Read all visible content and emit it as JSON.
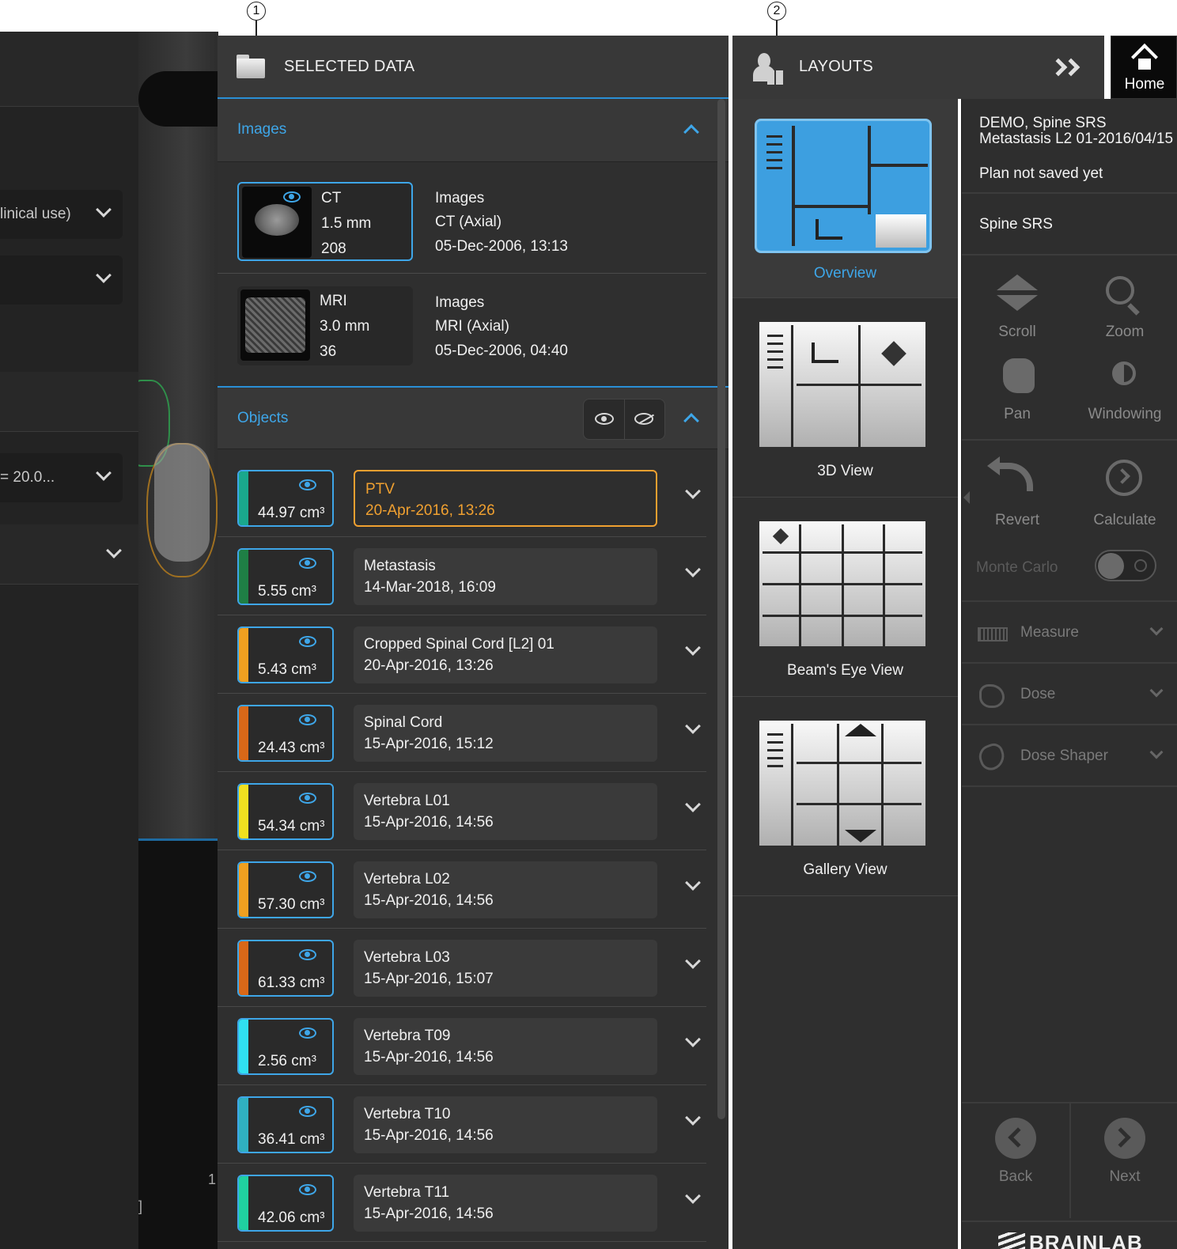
{
  "callouts": [
    "1",
    "2"
  ],
  "left_panel": {
    "dropdown1": "linical use)",
    "dropdown3": "= 20.0...",
    "lower_text_1": "1",
    "lower_text_2": "]"
  },
  "selected_data": {
    "title": "SELECTED DATA",
    "images_label": "Images",
    "images": [
      {
        "modality": "CT",
        "slice": "1.5 mm",
        "count": "208",
        "type": "Images",
        "desc": "CT (Axial)",
        "date": "05-Dec-2006, 13:13",
        "selected": true
      },
      {
        "modality": "MRI",
        "slice": "3.0 mm",
        "count": "36",
        "type": "Images",
        "desc": "MRI (Axial)",
        "date": "05-Dec-2006, 04:40",
        "selected": false
      }
    ],
    "objects_label": "Objects",
    "objects": [
      {
        "volume": "44.97 cm³",
        "name": "PTV",
        "date": "20-Apr-2016, 13:26",
        "color": "#1aa88c",
        "selected": true
      },
      {
        "volume": "5.55 cm³",
        "name": "Metastasis",
        "date": "14-Mar-2018, 16:09",
        "color": "#1f7f45",
        "selected": false
      },
      {
        "volume": "5.43 cm³",
        "name": "Cropped Spinal Cord [L2] 01",
        "date": "20-Apr-2016, 13:26",
        "color": "#f0a020",
        "selected": false
      },
      {
        "volume": "24.43 cm³",
        "name": "Spinal Cord",
        "date": "15-Apr-2016, 15:12",
        "color": "#d86818",
        "selected": false
      },
      {
        "volume": "54.34 cm³",
        "name": "Vertebra L01",
        "date": "15-Apr-2016, 14:56",
        "color": "#f0e020",
        "selected": false
      },
      {
        "volume": "57.30 cm³",
        "name": "Vertebra L02",
        "date": "15-Apr-2016, 14:56",
        "color": "#f0a020",
        "selected": false
      },
      {
        "volume": "61.33 cm³",
        "name": "Vertebra L03",
        "date": "15-Apr-2016, 15:07",
        "color": "#d86818",
        "selected": false
      },
      {
        "volume": "2.56 cm³",
        "name": "Vertebra T09",
        "date": "15-Apr-2016, 14:56",
        "color": "#30e0f0",
        "selected": false
      },
      {
        "volume": "36.41 cm³",
        "name": "Vertebra T10",
        "date": "15-Apr-2016, 14:56",
        "color": "#30b0c0",
        "selected": false
      },
      {
        "volume": "42.06 cm³",
        "name": "Vertebra T11",
        "date": "15-Apr-2016, 14:56",
        "color": "#20d0a0",
        "selected": false
      }
    ]
  },
  "layouts": {
    "title": "LAYOUTS",
    "items": [
      {
        "label": "Overview",
        "selected": true
      },
      {
        "label": "3D View",
        "selected": false
      },
      {
        "label": "Beam's Eye View",
        "selected": false
      },
      {
        "label": "Gallery View",
        "selected": false
      }
    ]
  },
  "home": {
    "label": "Home"
  },
  "right_panel": {
    "patient_line1": "DEMO, Spine SRS",
    "patient_line2": "Metastasis L2 01-2016/04/15",
    "plan_status": "Plan not saved yet",
    "plan_name": "Spine SRS",
    "tools": {
      "scroll": "Scroll",
      "zoom": "Zoom",
      "pan": "Pan",
      "windowing": "Windowing",
      "revert": "Revert",
      "calculate": "Calculate",
      "monte_carlo": "Monte Carlo"
    },
    "accordions": [
      "Measure",
      "Dose",
      "Dose Shaper"
    ],
    "back": "Back",
    "next": "Next",
    "brand": "BRAINLAB"
  }
}
